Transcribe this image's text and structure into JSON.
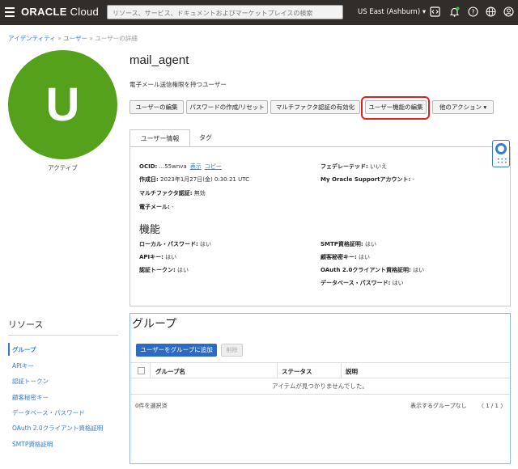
{
  "header": {
    "brand_bold": "ORACLE",
    "brand_light": " Cloud",
    "search_placeholder": "リソース、サービス、ドキュメントおよびマーケットプレイスの検索",
    "region": "US East (Ashburn)",
    "icons": [
      "menu-icon",
      "code-icon",
      "bell-icon",
      "help-icon",
      "globe-icon",
      "user-icon"
    ]
  },
  "breadcrumb": {
    "items": [
      "アイデンティティ",
      "ユーザー",
      "ユーザーの詳細"
    ],
    "separator": "»"
  },
  "user": {
    "initial": "U",
    "status": "アクティブ",
    "name": "mail_agent",
    "description": "電子メール送信権限を持つユーザー",
    "avatar_color": "#55a11c"
  },
  "actions": {
    "edit_user": "ユーザーの編集",
    "create_reset_password": "パスワードの作成/リセット",
    "enable_mfa": "マルチファクタ認証の有効化",
    "edit_capabilities": "ユーザー機能の編集",
    "more_actions": "他のアクション"
  },
  "tabs": {
    "user_info": "ユーザー情報",
    "tags": "タグ"
  },
  "info": {
    "ocid_label": "OCID:",
    "ocid_value": " ...55wnva",
    "show": "表示",
    "copy": "コピー",
    "created_label": "作成日:",
    "created_value": " 2023年1月27日(金) 0:30:21 UTC",
    "mfa_label": "マルチファクタ認証:",
    "mfa_value": " 無効",
    "email_label": "電子メール:",
    "email_value": " -",
    "federated_label": "フェデレーテッド:",
    "federated_value": " いいえ",
    "mos_label": "My Oracle Supportアカウント:",
    "mos_value": " -"
  },
  "capabilities": {
    "title": "機能",
    "local_password_label": "ローカル・パスワード:",
    "local_password_value": " はい",
    "api_keys_label": "APIキー:",
    "api_keys_value": " はい",
    "auth_tokens_label": "認証トークン:",
    "auth_tokens_value": " はい",
    "smtp_label": "SMTP資格証明:",
    "smtp_value": " はい",
    "customer_secret_label": "顧客秘密キー:",
    "customer_secret_value": " はい",
    "oauth_label": "OAuth 2.0クライアント資格証明:",
    "oauth_value": " はい",
    "db_password_label": "データベース・パスワード:",
    "db_password_value": " はい"
  },
  "resources": {
    "title": "リソース",
    "items": [
      "グループ",
      "APIキー",
      "認証トークン",
      "顧客秘密キー",
      "データベース・パスワード",
      "OAuth 2.0クライアント資格証明",
      "SMTP資格証明"
    ]
  },
  "groups": {
    "title": "グループ",
    "add_button": "ユーザーをグループに追加",
    "delete_button": "削除",
    "columns": [
      "グループ名",
      "ステータス",
      "説明"
    ],
    "empty_message": "アイテムが見つかりませんでした。",
    "selected_count": "0件を選択済",
    "no_groups": "表示するグループなし",
    "pagination": "1 / 1"
  }
}
